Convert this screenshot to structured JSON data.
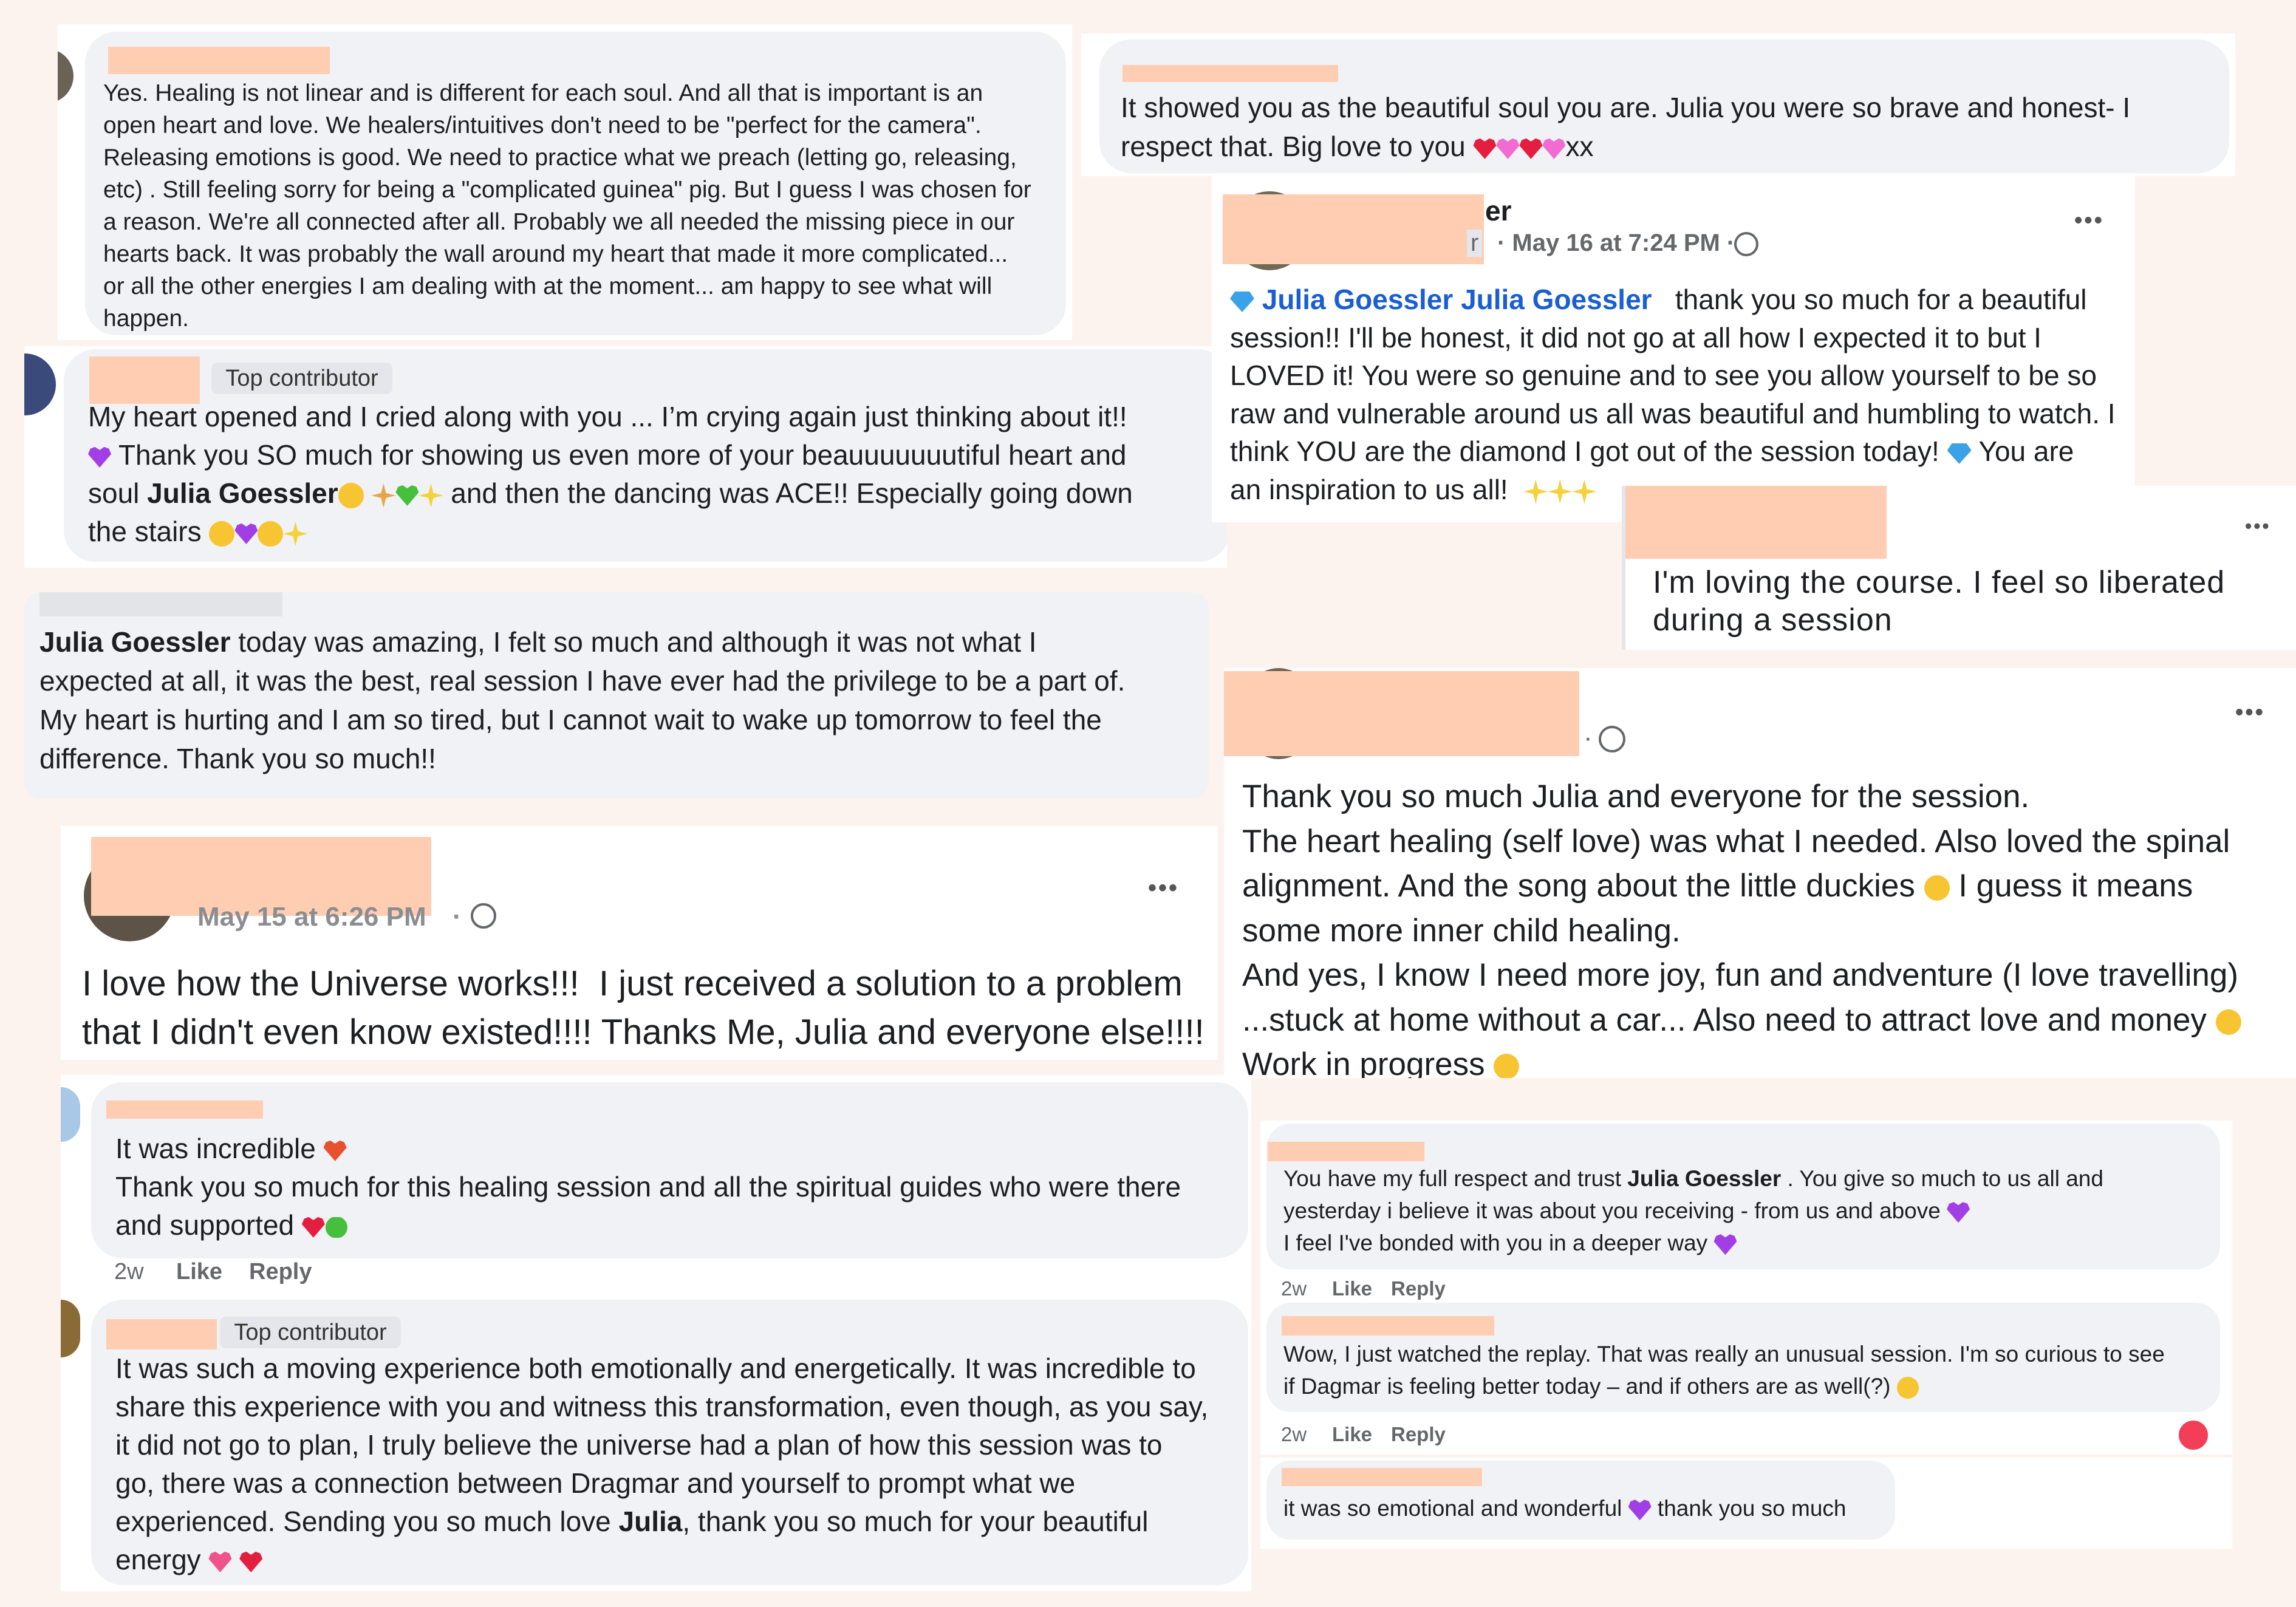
{
  "colors": {
    "background": "#fdf3ee",
    "bubble": "#f0f2f5",
    "redaction": "#ffcdb2",
    "link": "#1a5fd0",
    "meta": "#65676b"
  },
  "c1": {
    "text": "Yes. Healing is not linear and is different for each soul. And all that is important is an\nopen heart and love. We healers/intuitives don't need to be \"perfect for the camera\".\nReleasing emotions is good. We need to practice what we preach (letting go, releasing,\netc) . Still feeling sorry for being a \"complicated guinea\" pig. But I guess I was chosen for\na reason. We're all connected after all. Probably we all needed the missing piece in our\nhearts back. It was probably the wall around my heart that made it more complicated...\nor all the other energies I am dealing with at the moment... am happy to see what will\nhappen."
  },
  "c2": {
    "badge": "Top contributor",
    "text_a": "My heart opened and I cried along with you ... I’m crying again just thinking about it!!\n",
    "text_b": " Thank you SO much for showing us even more of your beauuuuuuutiful heart and\nsoul ",
    "name": "Julia Goessler",
    "text_c": " and then the dancing was ACE!! Especially going down\nthe stairs "
  },
  "c3": {
    "name": "Julia Goessler",
    "text": " today was amazing, I felt so much and although it was not what I\nexpected at all, it was the best, real session I have ever had the privilege to be a part of.\nMy heart is hurting and I am so tired, but I cannot wait to wake up tomorrow to feel the\ndifference. Thank you so much!!"
  },
  "c4": {
    "date": "May 15 at 6:26 PM",
    "sep": "·",
    "menu": "•••",
    "text": "I love how the Universe works!!!  I just received a solution to a problem\nthat I didn't even know existed!!!! Thanks Me, Julia and everyone else!!!!"
  },
  "c5": {
    "line1": "It was incredible ",
    "line2": "Thank you so much for this healing session and all the spiritual guides who were there\nand supported ",
    "time": "2w",
    "like": "Like",
    "reply": "Reply"
  },
  "c6": {
    "badge": "Top contributor",
    "text_a": "It was such a moving experience both emotionally and energetically. It was incredible to\nshare this experience with you and witness this transformation, even though, as you say,\nit did not go to plan, I truly believe the universe had a plan of how this session was to\ngo, there was a connection between Dragmar and yourself to prompt what we\nexperienced. Sending you so much love ",
    "name": "Julia",
    "text_b": ", thank you so much for your beautiful\nenergy "
  },
  "c7": {
    "text": "It showed you as the beautiful soul you are. Julia you were so brave and honest- I\nrespect that. Big love to you ",
    "xx": "xx"
  },
  "c8": {
    "name_suffix": "er",
    "role_suffix": "r",
    "date": "· May 16 at 7:24 PM ·",
    "menu": "•••",
    "tag1": "Julia Goessler",
    "tag2": "Julia Goessler",
    "text_a": "   thank you so much for a beautiful\nsession!! I'll be honest, it did not go at all how I expected it to but I\nLOVED it! You were so genuine and to see you allow yourself to be so\nraw and vulnerable around us all was beautiful and humbling to watch. I\nthink YOU are the diamond I got out of the session today! ",
    "text_b": " You are\nan inspiration to us all!  "
  },
  "c9": {
    "menu": "•••",
    "text": "I'm loving the course. I feel so liberated\nduring a session"
  },
  "c10": {
    "sep": "·",
    "menu": "•••",
    "text_a": "Thank you so much Julia and everyone for the session.\nThe heart healing (self love) was what I needed. Also loved the spinal\nalignment. And the song about the little duckies ",
    "text_b": " I guess it means\nsome more inner child healing.\nAnd yes, I know I need more joy, fun and andventure (I love travelling)\n...stuck at home without a car... Also need to attract love and money ",
    "text_c": "\nWork in progress "
  },
  "c11": {
    "text_a": "You have my full respect and trust ",
    "name": "Julia Goessler",
    "text_b": " . You give so much to us all and\nyesterday i believe it was about you receiving - from us and above ",
    "text_c": "\nI feel I've bonded with you in a deeper way ",
    "time": "2w",
    "like": "Like",
    "reply": "Reply"
  },
  "c12": {
    "text": "Wow, I just watched the replay. That was really an unusual session. I'm so curious to see\nif Dagmar is feeling better today – and if others are as well(?) ",
    "time": "2w",
    "like": "Like",
    "reply": "Reply"
  },
  "c13": {
    "text_a": "it was so emotional and wonderful ",
    "text_b": " thank you so much"
  },
  "icons": [
    "heart-icon",
    "smile-icon",
    "diamond-icon",
    "sparkles-icon",
    "globe-icon",
    "more-icon"
  ]
}
